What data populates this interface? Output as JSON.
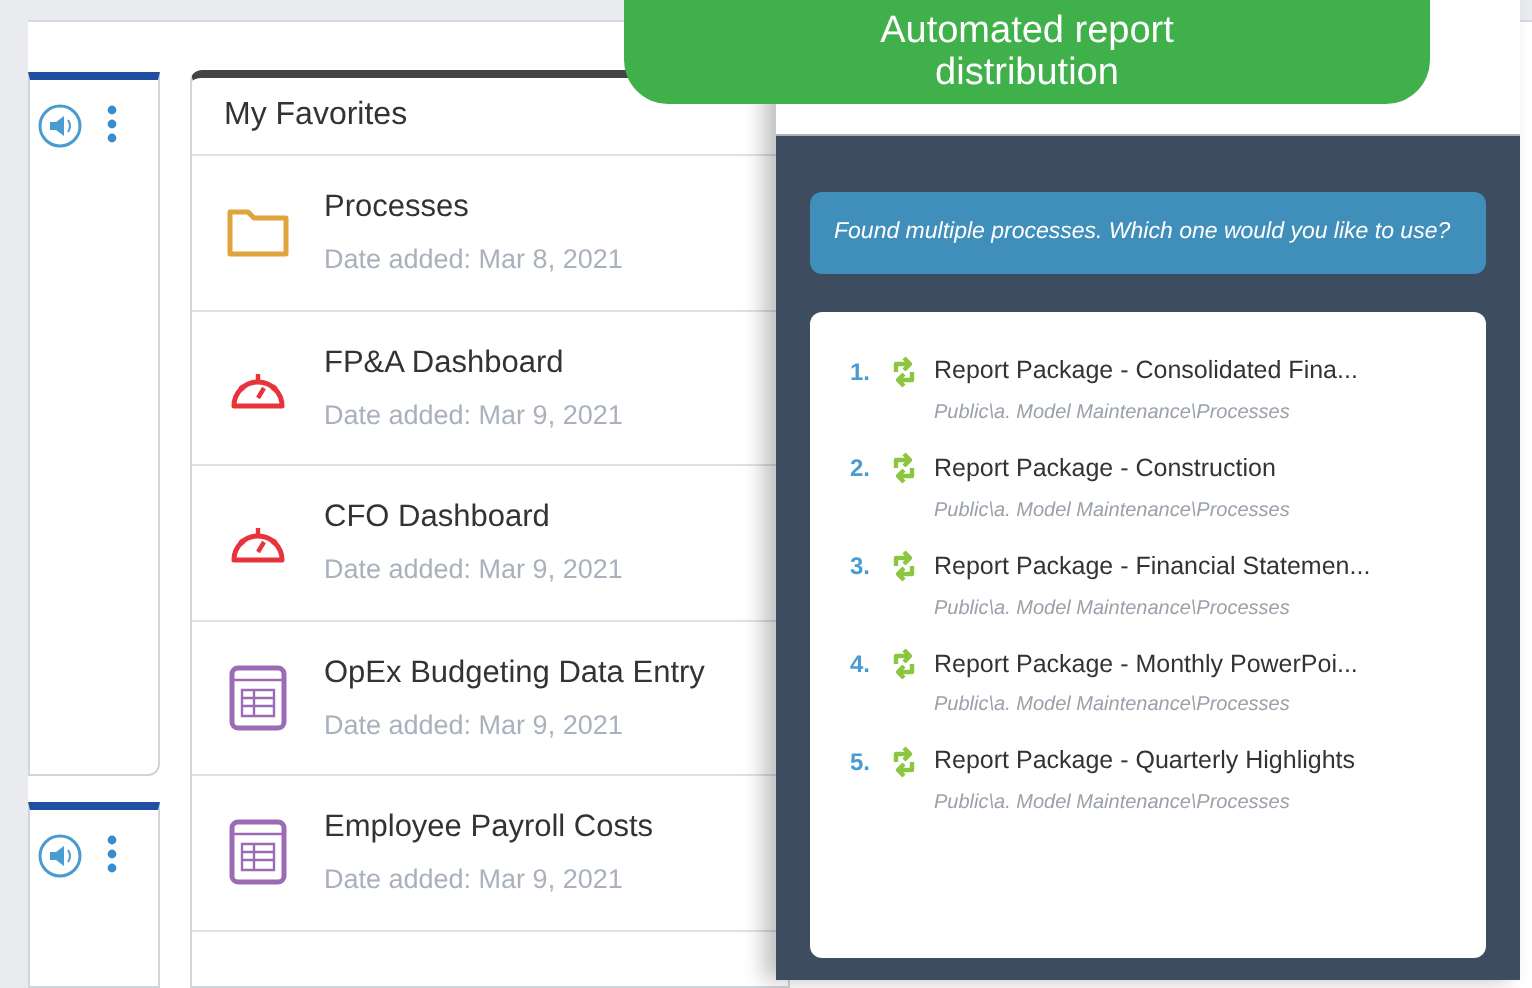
{
  "banner": {
    "lines": [
      "Automated report",
      "distribution"
    ]
  },
  "favorites": {
    "title": "My Favorites",
    "items": [
      {
        "kind": "folder",
        "name": "Processes",
        "date": "Date added: Mar 8, 2021"
      },
      {
        "kind": "dashboard",
        "name": "FP&A Dashboard",
        "date": "Date added: Mar 9, 2021"
      },
      {
        "kind": "dashboard",
        "name": "CFO Dashboard",
        "date": "Date added: Mar 9, 2021"
      },
      {
        "kind": "form",
        "name": "OpEx Budgeting Data Entry",
        "date": "Date added: Mar 9, 2021"
      },
      {
        "kind": "form",
        "name": "Employee Payroll Costs",
        "date": "Date added: Mar 9, 2021"
      }
    ]
  },
  "chat": {
    "message": "Found multiple processes. Which one would you like to use?",
    "options": [
      {
        "number": "1.",
        "title": "Report Package - Consolidated Fina...",
        "path": "Public\\a. Model Maintenance\\Processes"
      },
      {
        "number": "2.",
        "title": "Report Package - Construction",
        "path": "Public\\a. Model Maintenance\\Processes"
      },
      {
        "number": "3.",
        "title": "Report Package - Financial Statemen...",
        "path": "Public\\a. Model Maintenance\\Processes"
      },
      {
        "number": "4.",
        "title": "Report Package - Monthly PowerPoi...",
        "path": "Public\\a. Model Maintenance\\Processes"
      },
      {
        "number": "5.",
        "title": "Report Package - Quarterly Highlights",
        "path": "Public\\a. Model Maintenance\\Processes"
      }
    ]
  }
}
